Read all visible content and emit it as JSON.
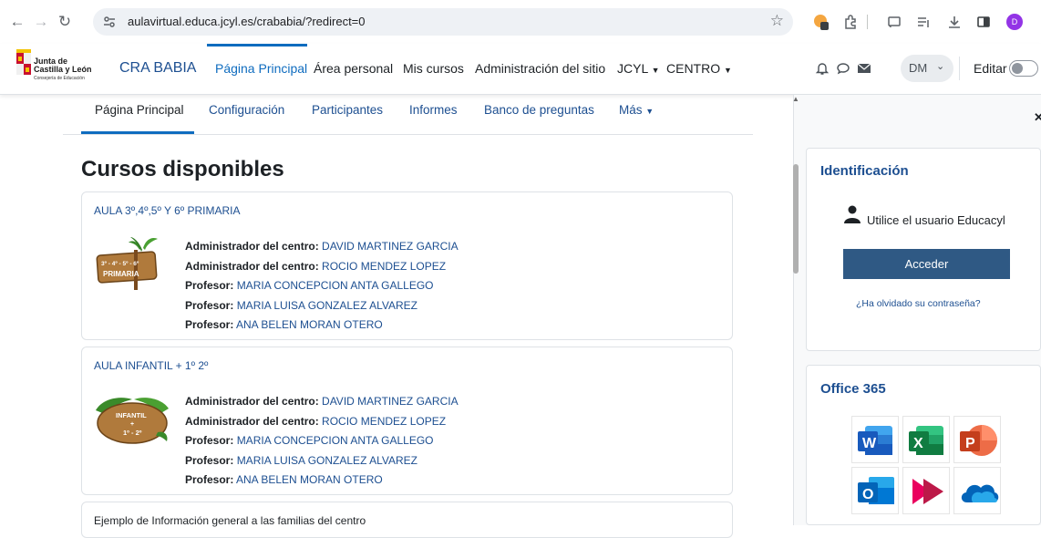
{
  "browser": {
    "url": "aulavirtual.educa.jcyl.es/crababia/?redirect=0",
    "profile_initial": "D"
  },
  "logo": {
    "line1": "Junta de",
    "line2": "Castilla y León",
    "line3": "Consejería de Educación"
  },
  "navbar": {
    "site_name": "CRA BABIA",
    "items": [
      {
        "label": "Página Principal"
      },
      {
        "label": "Área personal"
      },
      {
        "label": "Mis cursos"
      },
      {
        "label": "Administración del sitio"
      },
      {
        "label": "JCYL"
      },
      {
        "label": "CENTRO"
      }
    ],
    "user_initials": "DM",
    "edit_label": "Editar"
  },
  "secondary_tabs": [
    {
      "label": "Página Principal"
    },
    {
      "label": "Configuración"
    },
    {
      "label": "Participantes"
    },
    {
      "label": "Informes"
    },
    {
      "label": "Banco de preguntas"
    },
    {
      "label": "Más"
    }
  ],
  "main": {
    "heading": "Cursos disponibles",
    "courses": [
      {
        "title": "AULA 3º,4º,5º Y 6º PRIMARIA",
        "image_text": [
          "3º - 4º - 5º - 6º",
          "PRIMARIA"
        ],
        "contacts": [
          {
            "role": "Administrador del centro:",
            "name": "DAVID MARTINEZ GARCIA"
          },
          {
            "role": "Administrador del centro:",
            "name": "ROCIO MENDEZ LOPEZ"
          },
          {
            "role": "Profesor:",
            "name": "MARIA CONCEPCION ANTA GALLEGO"
          },
          {
            "role": "Profesor:",
            "name": "MARIA LUISA GONZALEZ ALVAREZ"
          },
          {
            "role": "Profesor:",
            "name": "ANA BELEN MORAN OTERO"
          }
        ]
      },
      {
        "title": "AULA INFANTIL + 1º 2º",
        "image_text": [
          "INFANTIL",
          "+",
          "1º - 2º"
        ],
        "contacts": [
          {
            "role": "Administrador del centro:",
            "name": "DAVID MARTINEZ GARCIA"
          },
          {
            "role": "Administrador del centro:",
            "name": "ROCIO MENDEZ LOPEZ"
          },
          {
            "role": "Profesor:",
            "name": "MARIA CONCEPCION ANTA GALLEGO"
          },
          {
            "role": "Profesor:",
            "name": "MARIA LUISA GONZALEZ ALVAREZ"
          },
          {
            "role": "Profesor:",
            "name": "ANA BELEN MORAN OTERO"
          }
        ]
      },
      {
        "title": "Ejemplo de Información general a las familias del centro"
      }
    ]
  },
  "drawer": {
    "identification": {
      "title": "Identificación",
      "hint": "Utilice el usuario Educacyl",
      "login_label": "Acceder",
      "forgot_label": "¿Ha olvidado su contraseña?"
    },
    "office": {
      "title": "Office 365",
      "apps": [
        "word-icon",
        "excel-icon",
        "powerpoint-icon",
        "outlook-icon",
        "stream-icon",
        "onedrive-icon"
      ]
    }
  },
  "colors": {
    "accent": "#0f6cbf",
    "link": "#1d4f91",
    "button": "#2f5984"
  }
}
